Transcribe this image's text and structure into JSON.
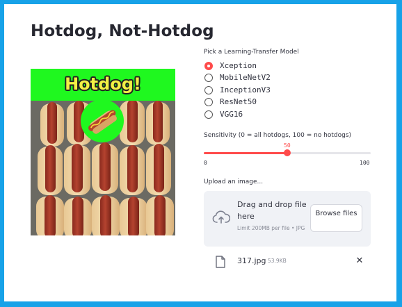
{
  "page": {
    "title": "Hotdog, Not-Hotdog"
  },
  "result": {
    "banner_text": "Hotdog!"
  },
  "model_picker": {
    "label": "Pick a Learning-Transfer Model",
    "options": [
      "Xception",
      "MobileNetV2",
      "InceptionV3",
      "ResNet50",
      "VGG16"
    ],
    "selected": "Xception"
  },
  "sensitivity": {
    "label": "Sensitivity (0 = all hotdogs, 100 = no hotdogs)",
    "value": "50",
    "min": "0",
    "max": "100",
    "fraction": 0.5
  },
  "uploader": {
    "label": "Upload an image...",
    "drag_text": "Drag and drop file here",
    "limit_text": "Limit 200MB per file • JPG",
    "browse_label": "Browse files",
    "file": {
      "name": "317.jpg",
      "size": "53.9KB"
    }
  },
  "icons": {
    "upload": "cloud-upload-icon",
    "file": "file-icon",
    "remove": "close-icon"
  },
  "colors": {
    "accent": "#ff4b4b",
    "banner": "#1ff81f",
    "banner_text": "#f3f044",
    "frame": "#17a2e8"
  }
}
